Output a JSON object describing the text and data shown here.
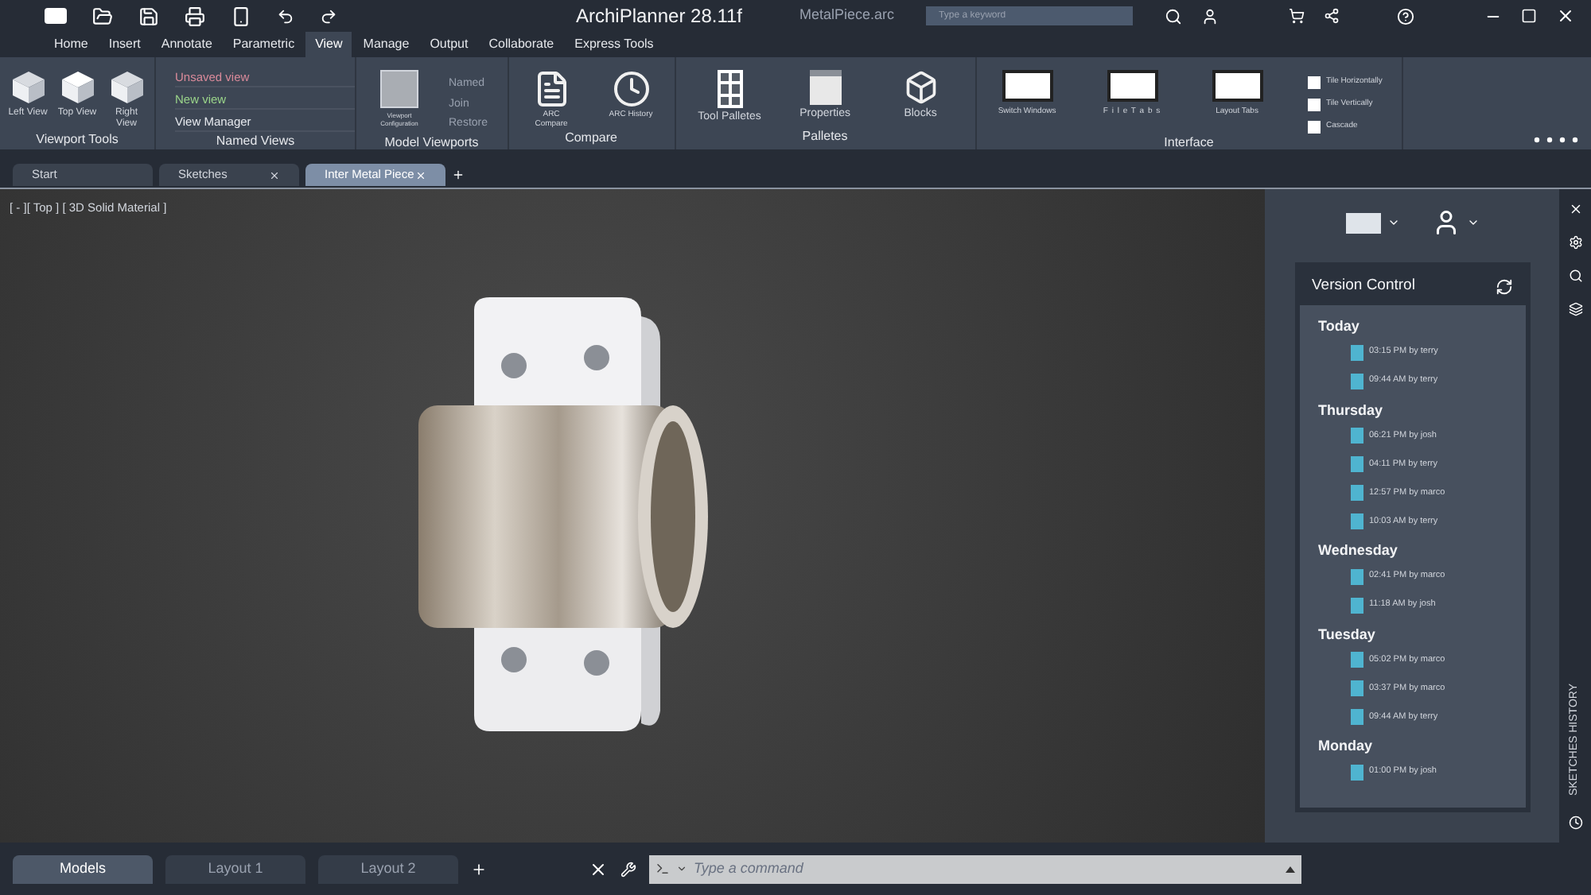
{
  "title_bar": {
    "title": "ArchiPlanner 28.11f",
    "file": "MetalPiece.arc",
    "search": {
      "placeholder": "Type a keyword"
    }
  },
  "ribbon_tabs": [
    {
      "label": "Home",
      "selected": false
    },
    {
      "label": "Insert",
      "selected": false
    },
    {
      "label": "Annotate",
      "selected": false
    },
    {
      "label": "Parametric",
      "selected": false
    },
    {
      "label": "View",
      "selected": true
    },
    {
      "label": "Manage",
      "selected": false
    },
    {
      "label": "Output",
      "selected": false
    },
    {
      "label": "Collaborate",
      "selected": false
    },
    {
      "label": "Express Tools",
      "selected": false
    }
  ],
  "ribbon_groups": [
    {
      "title": "Viewport Tools",
      "kind": "cubes",
      "items": [
        {
          "label": "Left View"
        },
        {
          "label": "Top View"
        },
        {
          "label": "Right View"
        }
      ]
    },
    {
      "title": "Named Views",
      "kind": "list",
      "items": [
        {
          "label": "Unsaved view",
          "color": "#d98a9a"
        },
        {
          "label": "New view",
          "color": "#9ad48a"
        },
        {
          "label": "View Manager",
          "color": "#e6e9ee"
        }
      ]
    },
    {
      "title": "Model Viewports",
      "kind": "viewports",
      "items": [
        {
          "label": "Viewport Configuration"
        },
        {
          "label": "Named"
        },
        {
          "label": "Join"
        },
        {
          "label": "Restore"
        }
      ]
    },
    {
      "title": "Compare",
      "kind": "compare",
      "items": [
        {
          "label": "ARC Compare"
        },
        {
          "label": "ARC History"
        }
      ]
    },
    {
      "title": "Palletes",
      "kind": "palletes",
      "items": [
        {
          "label": "Tool Palletes"
        },
        {
          "label": "Properties"
        },
        {
          "label": "Blocks"
        }
      ]
    },
    {
      "title": "Interface",
      "kind": "interface",
      "items": [
        {
          "label": "Switch Windows"
        },
        {
          "label": "F i l e T a b s"
        },
        {
          "label": "Layout Tabs"
        },
        {
          "label": "Tile Horizontally"
        },
        {
          "label": "Tile Vertically"
        },
        {
          "label": "Cascade"
        }
      ]
    }
  ],
  "doc_tabs": [
    {
      "label": "Start",
      "selected": false,
      "closable": false
    },
    {
      "label": "Sketches",
      "selected": false,
      "closable": true
    },
    {
      "label": "Inter Metal Piece",
      "selected": true,
      "closable": true
    }
  ],
  "viewport": {
    "label": "[ - ][ Top ] [ 3D Solid Material ]"
  },
  "version_control": {
    "title": "Version Control",
    "groups": [
      {
        "day": "Today",
        "entries": [
          "03:15 PM by terry",
          "09:44 AM by terry"
        ]
      },
      {
        "day": "Thursday",
        "entries": [
          "06:21 PM by josh",
          "04:11 PM by terry",
          "12:57 PM by marco",
          "10:03 AM by terry"
        ]
      },
      {
        "day": "Wednesday",
        "entries": [
          "02:41 PM by marco",
          "11:18 AM by josh"
        ]
      },
      {
        "day": "Tuesday",
        "entries": [
          "05:02 PM by marco",
          "03:37 PM by marco",
          "09:44 AM by terry"
        ]
      },
      {
        "day": "Monday",
        "entries": [
          "01:00 PM by josh"
        ]
      }
    ]
  },
  "side_strip": {
    "label": "SKETCHES HISTORY"
  },
  "layout_tabs": [
    {
      "label": "Models",
      "selected": true
    },
    {
      "label": "Layout 1",
      "selected": false
    },
    {
      "label": "Layout 2",
      "selected": false
    }
  ],
  "command": {
    "placeholder": "Type a command"
  }
}
